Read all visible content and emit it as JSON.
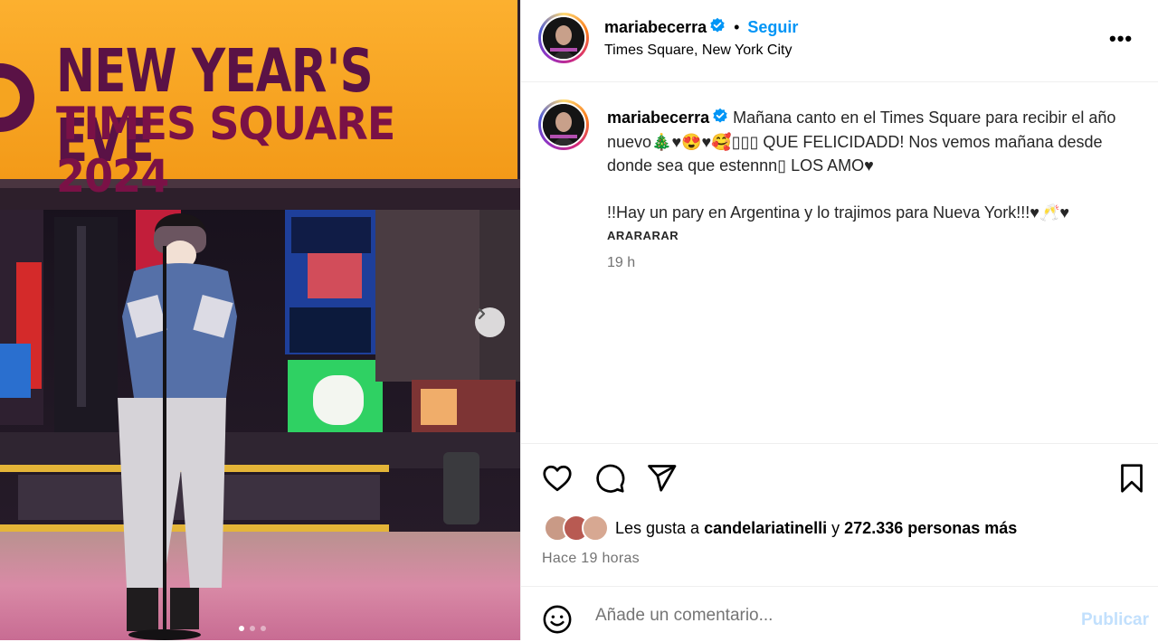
{
  "post": {
    "banner_line1": "NEW YEAR'S EVE",
    "banner_line2": "TIMES SQUARE 2024",
    "carousel_total": 3,
    "carousel_active": 1
  },
  "header": {
    "username": "mariabecerra",
    "separator": "•",
    "follow_label": "Seguir",
    "location": "Times Square, New York City",
    "more_label": "•••"
  },
  "caption": {
    "username": "mariabecerra",
    "line1": "Mañana canto en el Times Square para recibir el año nuevo🎄♥😍♥🥰▯▯▯ QUE FELICIDADD! Nos vemos mañana desde donde sea que estennn▯ LOS AMO♥",
    "line2": "!!Hay un pary en Argentina y lo trajimos para Nueva York!!!♥🥂♥",
    "tag": "ARARARAR",
    "time": "19 h"
  },
  "likes": {
    "prefix": "Les gusta a ",
    "user": "candelariatinelli",
    "middle": " y ",
    "count": "272.336 personas más"
  },
  "posted": "Hace 19 horas",
  "comment": {
    "placeholder": "Añade un comentario...",
    "publish_label": "Publicar"
  },
  "colors": {
    "accent": "#0095f6",
    "muted": "#737373",
    "publish_disabled": "#c2e0fd"
  },
  "icons": {
    "like": "heart-icon",
    "comment": "comment-bubble-icon",
    "share": "paper-plane-icon",
    "save": "bookmark-icon",
    "emoji": "smiley-icon",
    "next": "chevron-right-icon",
    "verified": "verified-badge-icon"
  }
}
